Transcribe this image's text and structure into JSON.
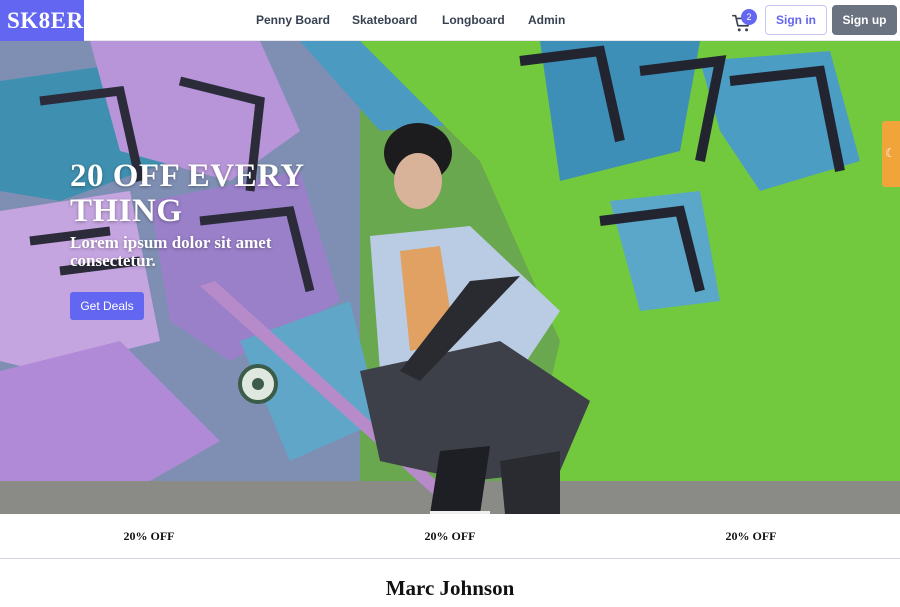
{
  "brand": {
    "logo": "SK8ER",
    "accent": "#6366f1"
  },
  "nav": [
    {
      "label": "Penny Board"
    },
    {
      "label": "Skateboard"
    },
    {
      "label": "Longboard"
    },
    {
      "label": "Admin"
    }
  ],
  "cart": {
    "icon": "cart-icon",
    "count": "2"
  },
  "auth": {
    "signin_label": "Sign in",
    "signup_label": "Sign up"
  },
  "hero": {
    "title": "20 OFF EVERY THING",
    "subtitle": "Lorem ipsum dolor sit amet consectetur.",
    "cta_label": "Get Deals",
    "image": "skater-with-graffiti-wall"
  },
  "theme_toggle": {
    "icon": "moon-icon",
    "color": "#f0a43a"
  },
  "promos": [
    {
      "label": "20% OFF"
    },
    {
      "label": "20% OFF"
    },
    {
      "label": "20% OFF"
    }
  ],
  "section": {
    "title": "Marc Johnson"
  }
}
